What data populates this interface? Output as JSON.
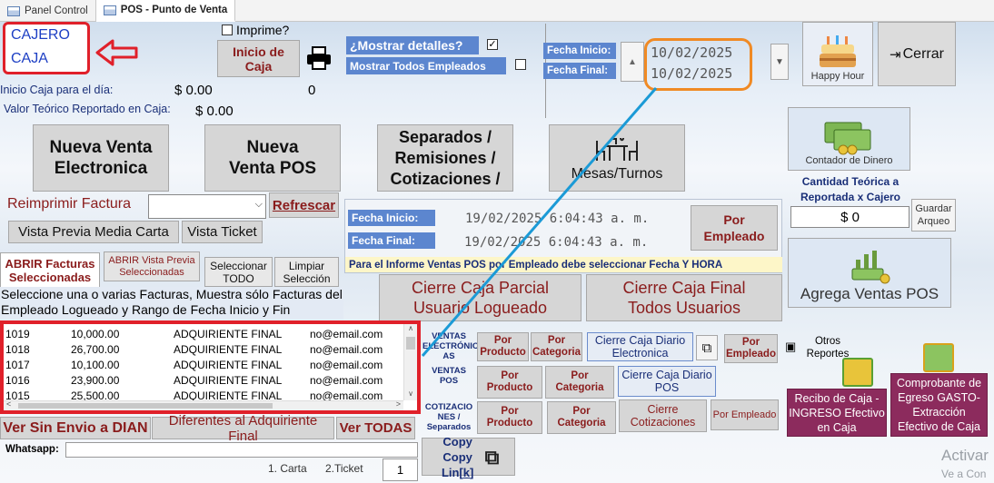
{
  "tabs": [
    {
      "label": "Panel Control"
    },
    {
      "label": "POS - Punto de Venta"
    }
  ],
  "annotation": {
    "cajero": "CAJERO",
    "caja": "CAJA"
  },
  "header": {
    "imprime_label": "Imprime?",
    "inicio_caja_label": "Inicio de Caja",
    "mostrar_detalles_label": "¿Mostrar detalles?",
    "mostrar_empleados_label": "Mostrar Todos Empleados",
    "fecha_inicio_label": "Fecha Inicio:",
    "fecha_final_label": "Fecha Final:",
    "fecha_inicio_value": "10/02/2025",
    "fecha_final_value": "10/02/2025",
    "happy_hour_label": "Happy Hour",
    "cerrar_label": "Cerrar"
  },
  "summary": {
    "inicio_caja_dia_label": "Inicio Caja para el día:",
    "inicio_caja_dia_value": "$ 0.00",
    "inicio_caja_count": "0",
    "valor_teorico_label": "Valor Teórico Reportado en Caja:",
    "valor_teorico_value": "$ 0.00"
  },
  "main_buttons": {
    "nueva_venta_electronica": "Nueva Venta Electronica",
    "nueva_venta_pos": "Nueva Venta POS",
    "separados": "Separados / Remisiones / Cotizaciones /",
    "mesas_turnos": "Mesas/Turnos",
    "contador_dinero": "Contador de Dinero"
  },
  "reprint": {
    "reimprimir_label": "Reimprimir Factura",
    "refrescar_label": "Refrescar",
    "vista_media_carta": "Vista Previa Media Carta",
    "vista_ticket": "Vista Ticket"
  },
  "cashier": {
    "cantidad_teorica_label": "Cantidad Teórica a Reportada x Cajero",
    "cantidad_value": "$ 0",
    "guardar_arqueo": "Guardar Arqueo",
    "agrega_ventas_pos": "Agrega Ventas POS"
  },
  "report_dates": {
    "fecha_inicio_label": "Fecha Inicio:",
    "fecha_final_label": "Fecha Final:",
    "fecha_inicio_value": "19/02/2025 6:04:43 a. m.",
    "fecha_final_value": "19/02/2025 6:04:43 a. m.",
    "por_empleado": "Por Empleado",
    "informe_note": "Para el Informe Ventas POS por Empleado debe seleccionar Fecha Y HORA"
  },
  "invoice_tabs": {
    "abrir_facturas": "ABRIR Facturas Seleccionadas",
    "abrir_vista_previa": "ABRIR Vista Previa Seleccionadas",
    "seleccionar_todo": "Seleccionar TODO",
    "limpiar_seleccion": "Limpiar Selección",
    "instructions": "Seleccione una o varias Facturas, Muestra sólo Facturas del Empleado Logueado y Rango de Fecha Inicio y Fin"
  },
  "cierre": {
    "parcial": "Cierre Caja Parcial Usuario Logueado",
    "final": "Cierre Caja Final Todos Usuarios"
  },
  "invoices": [
    {
      "id": "1019",
      "amount": "10,000.00",
      "client": "ADQUIRIENTE FINAL",
      "email": "no@email.com"
    },
    {
      "id": "1018",
      "amount": "26,700.00",
      "client": "ADQUIRIENTE FINAL",
      "email": "no@email.com"
    },
    {
      "id": "1017",
      "amount": "10,100.00",
      "client": "ADQUIRIENTE FINAL",
      "email": "no@email.com"
    },
    {
      "id": "1016",
      "amount": "23,900.00",
      "client": "ADQUIRIENTE FINAL",
      "email": "no@email.com"
    },
    {
      "id": "1015",
      "amount": "25,500.00",
      "client": "ADQUIRIENTE FINAL",
      "email": "no@email.com"
    }
  ],
  "reports": {
    "ventas_electronicas": "VENTAS ELECTRÓNIC AS",
    "ventas_pos": "VENTAS POS",
    "cotizaciones": "COTIZACIO NES / Separados",
    "por_producto": "Por Producto",
    "por_categoria": "Por Categoria",
    "cierre_diario_electronica": "Cierre Caja Diario Electronica",
    "cierre_diario_pos": "Cierre Caja Diario POS",
    "por_empleado": "Por Empleado",
    "cierre_cotizaciones": "Cierre Cotizaciones",
    "otros_reportes": "Otros Reportes",
    "recibo_caja": "Recibo de Caja - INGRESO Efectivo en Caja",
    "comprobante_egreso": "Comprobante de Egreso GASTO- Extracción Efectivo de Caja"
  },
  "bottom": {
    "ver_sin_envio": "Ver Sin Envio a DIAN",
    "diferentes": "Diferentes al Adquiriente Final",
    "ver_todas": "Ver TODAS",
    "whatsapp_label": "Whatsapp:",
    "opt_carta": "1. Carta",
    "opt_ticket": "2.Ticket",
    "copies_value": "1",
    "copy_link_a": "Copy Lin[",
    "copy_link_k": "k",
    "copy_link_b": "]"
  },
  "watermark": {
    "line1": "Activar",
    "line2": "Ve a Con"
  },
  "colors": {
    "annotation_red": "#e0202a",
    "annotation_orange": "#f08a24",
    "annotation_blue": "#1b9ad6",
    "band_blue": "#5c86cf",
    "maroon": "#8c2b5d"
  }
}
